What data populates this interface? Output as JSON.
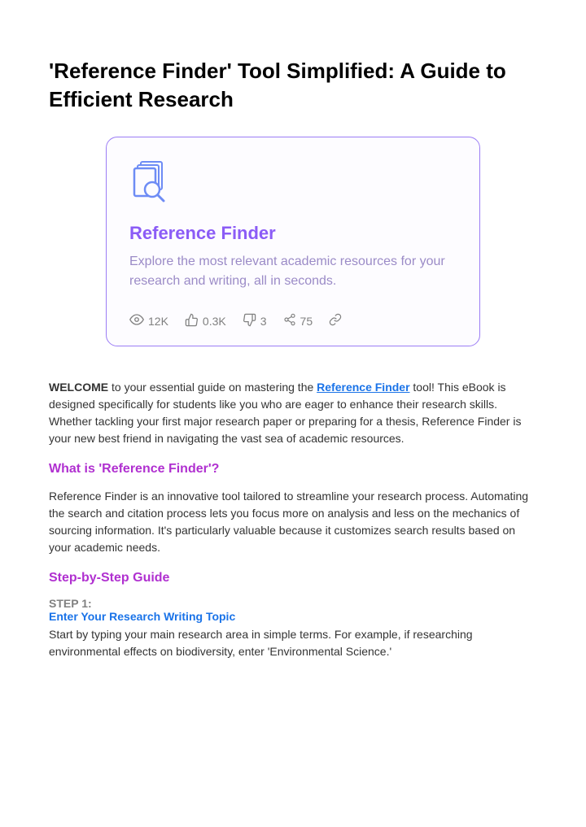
{
  "title": "'Reference Finder' Tool Simplified: A Guide to Efficient Research",
  "card": {
    "title": "Reference Finder",
    "description": "Explore the most relevant academic resources for your research and writing, all in seconds.",
    "stats": {
      "views": "12K",
      "likes": "0.3K",
      "dislikes": "3",
      "shares": "75"
    }
  },
  "intro": {
    "welcome": "WELCOME",
    "part1": " to your essential guide on mastering the ",
    "link": "Reference Finder",
    "part2": " tool! This eBook is designed specifically for students like you who are eager to enhance their research skills. Whether tackling your first major research paper or preparing for a thesis, Reference Finder is your new best friend in navigating the vast sea of academic resources."
  },
  "section1": {
    "heading": "What is 'Reference Finder'?",
    "body": "Reference Finder is an innovative tool tailored to streamline your research process. Automating the search and citation process lets you focus more on analysis and less on the mechanics of sourcing information. It's particularly valuable because it customizes search results based on your academic needs."
  },
  "section2": {
    "heading": "Step-by-Step Guide",
    "step_label": "STEP 1:",
    "step_title": "Enter Your Research Writing Topic",
    "step_body": "Start by typing your main research area in simple terms. For example, if researching environmental effects on biodiversity, enter 'Environmental Science.'"
  }
}
